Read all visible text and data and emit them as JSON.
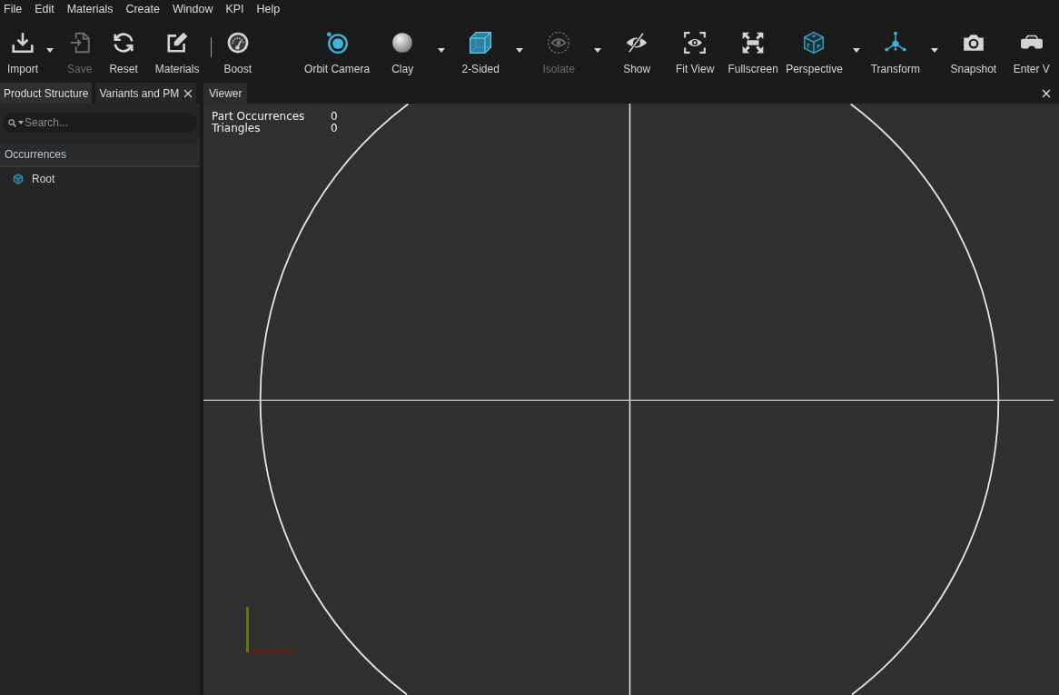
{
  "menu_bar": {
    "items": [
      "File",
      "Edit",
      "Materials",
      "Create",
      "Window",
      "KPI",
      "Help"
    ]
  },
  "toolbar": {
    "groups": [
      {
        "tools": [
          {
            "kind": "tool",
            "label": "Import",
            "dropdown": true,
            "disabled": false
          },
          {
            "kind": "tool",
            "label": "Save",
            "dropdown": false,
            "disabled": true
          },
          {
            "kind": "tool",
            "label": "Reset",
            "dropdown": false,
            "disabled": false
          },
          {
            "kind": "tool",
            "label": "Materials",
            "dropdown": false,
            "disabled": false
          },
          {
            "kind": "separator"
          },
          {
            "kind": "tool",
            "label": "Boost",
            "dropdown": false,
            "disabled": false
          }
        ]
      },
      {
        "tools": [
          {
            "kind": "tool",
            "label": "Orbit Camera",
            "dropdown": false,
            "disabled": false
          },
          {
            "kind": "tool",
            "label": "Clay",
            "dropdown": true,
            "disabled": false
          },
          {
            "kind": "tool",
            "label": "2-Sided",
            "dropdown": true,
            "disabled": false
          },
          {
            "kind": "tool",
            "label": "Isolate",
            "dropdown": true,
            "disabled": true
          },
          {
            "kind": "tool",
            "label": "Show",
            "dropdown": false,
            "disabled": false
          },
          {
            "kind": "tool",
            "label": "Fit View",
            "dropdown": false,
            "disabled": false
          },
          {
            "kind": "tool",
            "label": "Fullscreen",
            "dropdown": false,
            "disabled": false
          },
          {
            "kind": "tool",
            "label": "Perspective",
            "dropdown": true,
            "disabled": false
          },
          {
            "kind": "tool",
            "label": "Transform",
            "dropdown": true,
            "disabled": false
          },
          {
            "kind": "tool",
            "label": "Snapshot",
            "dropdown": false,
            "disabled": false
          },
          {
            "kind": "tool",
            "label": "Enter V",
            "dropdown": false,
            "disabled": false
          }
        ]
      }
    ]
  },
  "left_panel": {
    "tabs": [
      {
        "label": "Product Structure",
        "selected": true,
        "closable": false
      },
      {
        "label": "Variants and PM",
        "selected": false,
        "closable": true
      }
    ],
    "search": {
      "placeholder": "Search..."
    },
    "tree_header": "Occurrences",
    "tree": [
      {
        "label": "Root"
      }
    ]
  },
  "viewer": {
    "tab": "Viewer",
    "stats": [
      {
        "label": "Part Occurrences",
        "value": "0"
      },
      {
        "label": "Triangles",
        "value": "0"
      }
    ]
  }
}
